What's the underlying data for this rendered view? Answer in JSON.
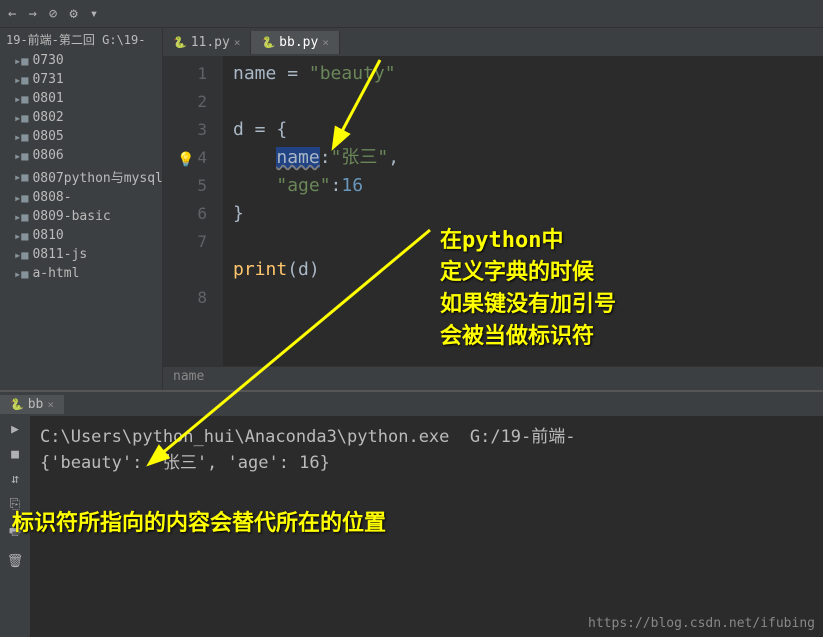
{
  "toolbar": {
    "icons": [
      "←",
      "→",
      "⊘",
      "⚙",
      "▾"
    ]
  },
  "sidebar": {
    "header": "19-前端-第二回  G:\\19-",
    "items": [
      {
        "label": "0730"
      },
      {
        "label": "0731"
      },
      {
        "label": "0801"
      },
      {
        "label": "0802"
      },
      {
        "label": "0805"
      },
      {
        "label": "0806"
      },
      {
        "label": "0807python与mysql"
      },
      {
        "label": "0808-"
      },
      {
        "label": "0809-basic"
      },
      {
        "label": "0810"
      },
      {
        "label": "0811-js"
      },
      {
        "label": "a-html"
      }
    ]
  },
  "tabs": [
    {
      "label": "11.py",
      "active": false
    },
    {
      "label": "bb.py",
      "active": true
    }
  ],
  "gutter": [
    "1",
    "2",
    "3",
    "4",
    "5",
    "6",
    "7",
    "8"
  ],
  "code": {
    "l1_var": "name",
    "l1_eq": " = ",
    "l1_str": "\"beauty\"",
    "l3_var": "d",
    "l3_eq": " = {",
    "l4_indent": "    ",
    "l4_key": "name",
    "l4_colon": ":",
    "l4_val": "\"张三\"",
    "l4_comma": ",",
    "l5_indent": "    ",
    "l5_key": "\"age\"",
    "l5_colon": ":",
    "l5_val": "16",
    "l6": "}",
    "l8_fn": "print",
    "l8_open": "(",
    "l8_arg": "d",
    "l8_close": ")"
  },
  "breadcrumb": "name",
  "runTab": "bb",
  "console": {
    "line1": "C:\\Users\\python_hui\\Anaconda3\\python.exe  G:/19-前端-",
    "line2": "{'beauty': '张三', 'age': 16}"
  },
  "annotations": {
    "a1_l1": "在python中",
    "a1_l2": "定义字典的时候",
    "a1_l3": "如果键没有加引号",
    "a1_l4": "会被当做标识符",
    "a2": "标识符所指向的内容会替代所在的位置"
  },
  "watermark": "https://blog.csdn.net/ifubing"
}
